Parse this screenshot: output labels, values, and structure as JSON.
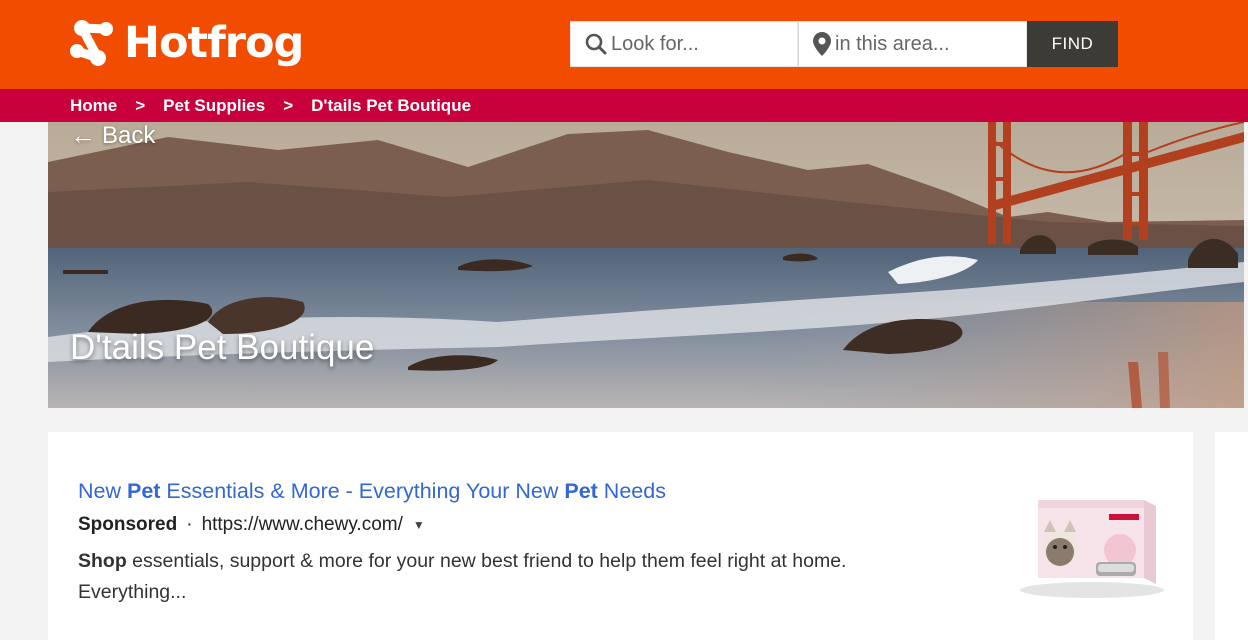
{
  "header": {
    "brand": "Hotfrog",
    "search_what_placeholder": "Look for...",
    "search_where_placeholder": "in this area...",
    "find_label": "FIND",
    "colors": {
      "header_bg": "#f24c00",
      "crumb_bg": "#c8003c",
      "find_bg": "#3d3b35"
    }
  },
  "breadcrumb": {
    "items": [
      "Home",
      "Pet Supplies",
      "D'tails Pet Boutique"
    ],
    "separator": ">"
  },
  "hero": {
    "back_label": "Back",
    "business_name": "D'tails Pet Boutique"
  },
  "ad": {
    "title_parts": [
      "New ",
      "Pet",
      " Essentials & More - Everything Your New ",
      "Pet",
      " Needs"
    ],
    "sponsored_label": "Sponsored",
    "dot": "·",
    "url": "https://www.chewy.com/",
    "caret": "▼",
    "desc_bold": "Shop",
    "desc_rest": " essentials, support & more for your new best friend to help them feel right at home. Everything...",
    "link_color": "#3367d6"
  }
}
